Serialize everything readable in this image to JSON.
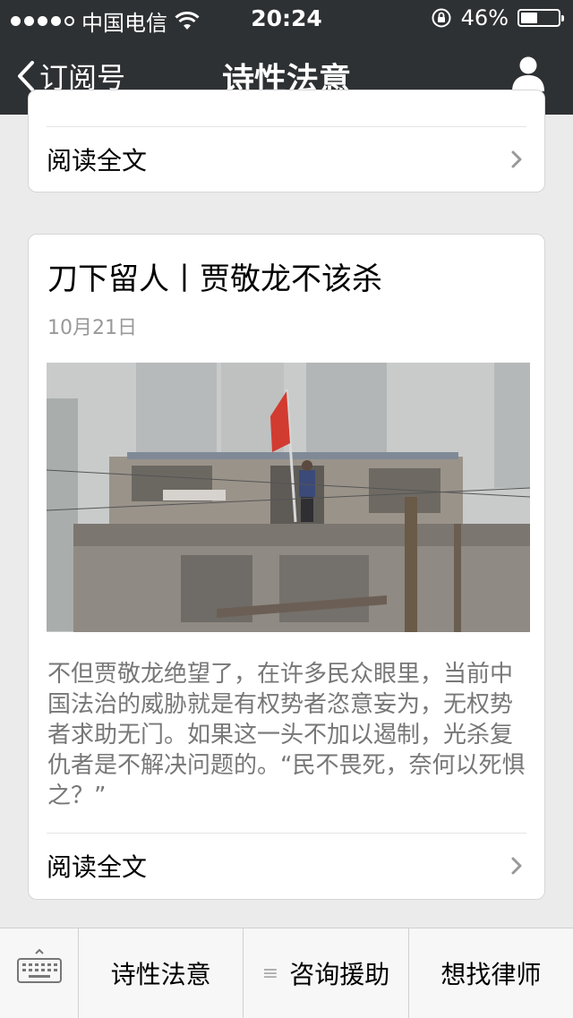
{
  "status_bar": {
    "signal_dots_filled": 4,
    "signal_dots_total": 5,
    "carrier": "中国电信",
    "time": "20:24",
    "battery_percent_text": "46%",
    "battery_level": 0.46,
    "icons": [
      "wifi-icon",
      "orientation-lock-icon",
      "battery-icon"
    ]
  },
  "nav": {
    "back_label": "订阅号",
    "title": "诗性法意",
    "right_icon": "person-icon"
  },
  "cards": [
    {
      "read_more_label": "阅读全文"
    },
    {
      "title": "刀下留人丨贾敬龙不该杀",
      "date": "10月21日",
      "digest": "不但贾敬龙绝望了，在许多民众眼里，当前中国法治的威胁就是有权势者恣意妄为，无权势者求助无门。如果这一头不加以遏制，光杀复仇者是不解决问题的。“民不畏死，奈何以死惧之？”",
      "read_more_label": "阅读全文"
    }
  ],
  "bottom_menu": {
    "keyboard_icon": "keyboard-icon",
    "items": [
      {
        "label": "诗性法意",
        "has_submenu": false
      },
      {
        "label": "咨询援助",
        "has_submenu": true
      },
      {
        "label": "想找律师",
        "has_submenu": false
      }
    ]
  },
  "colors": {
    "nav_bg": "#2e3133",
    "page_bg": "#ebebeb",
    "card_bg": "#ffffff",
    "digest_text": "#777777",
    "date_text": "#999999"
  }
}
